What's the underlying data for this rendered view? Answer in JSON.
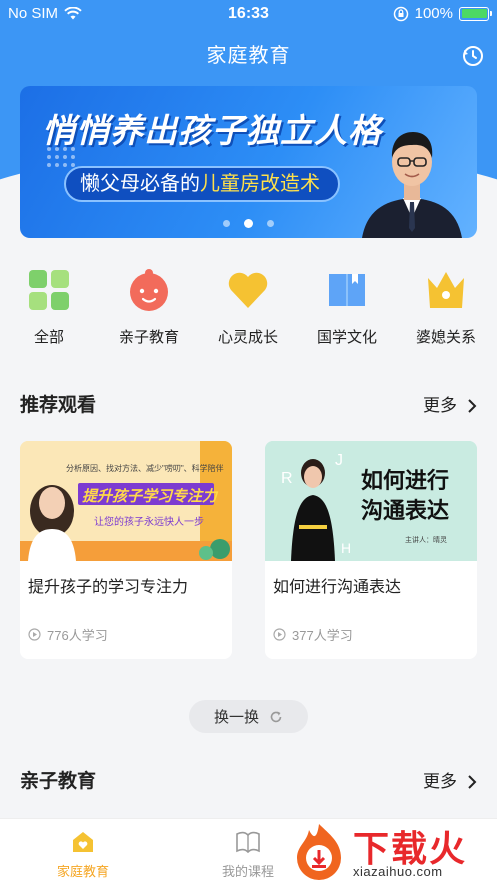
{
  "status_bar": {
    "carrier": "No SIM",
    "time": "16:33",
    "battery": "100%"
  },
  "nav": {
    "title": "家庭教育"
  },
  "banner": {
    "headline": "悄悄养出孩子独立人格",
    "subtitle_part1": "懒父母必备的",
    "subtitle_highlight": "儿童房改造术",
    "slide_count": 3,
    "active_slide": 2
  },
  "categories": [
    {
      "label": "全部",
      "icon": "grid-icon",
      "color": "#7ed06b"
    },
    {
      "label": "亲子教育",
      "icon": "baby-face-icon",
      "color": "#f26b5b"
    },
    {
      "label": "心灵成长",
      "icon": "heart-icon",
      "color": "#f5c232"
    },
    {
      "label": "国学文化",
      "icon": "book-icon",
      "color": "#5ea4f7"
    },
    {
      "label": "婆媳关系",
      "icon": "crown-icon",
      "color": "#f5c232"
    }
  ],
  "recommend": {
    "title": "推荐观看",
    "more": "更多",
    "cards": [
      {
        "title": "提升孩子的学习专注力",
        "learners": "776人学习",
        "thumb_banner": "提升孩子学习专注力",
        "thumb_sub": "让您的孩子永远快人一步",
        "thumb_tagline": "分析原因、找对方法、减少\"唠叨\"、科学陪伴"
      },
      {
        "title": "如何进行沟通表达",
        "learners": "377人学习",
        "thumb_line1": "如何进行",
        "thumb_line2": "沟通表达",
        "thumb_speaker": "主讲人：晴灵"
      }
    ]
  },
  "refresh": {
    "label": "换一换"
  },
  "parenting": {
    "title": "亲子教育",
    "more": "更多"
  },
  "tabs": [
    {
      "label": "家庭教育",
      "active": true
    },
    {
      "label": "我的课程",
      "active": false
    }
  ],
  "watermark": {
    "text": "下载火",
    "url": "xiazaihuo.com"
  },
  "colors": {
    "primary": "#3c96f5",
    "tab_active": "#f5a623",
    "tab_inactive": "#999999"
  }
}
